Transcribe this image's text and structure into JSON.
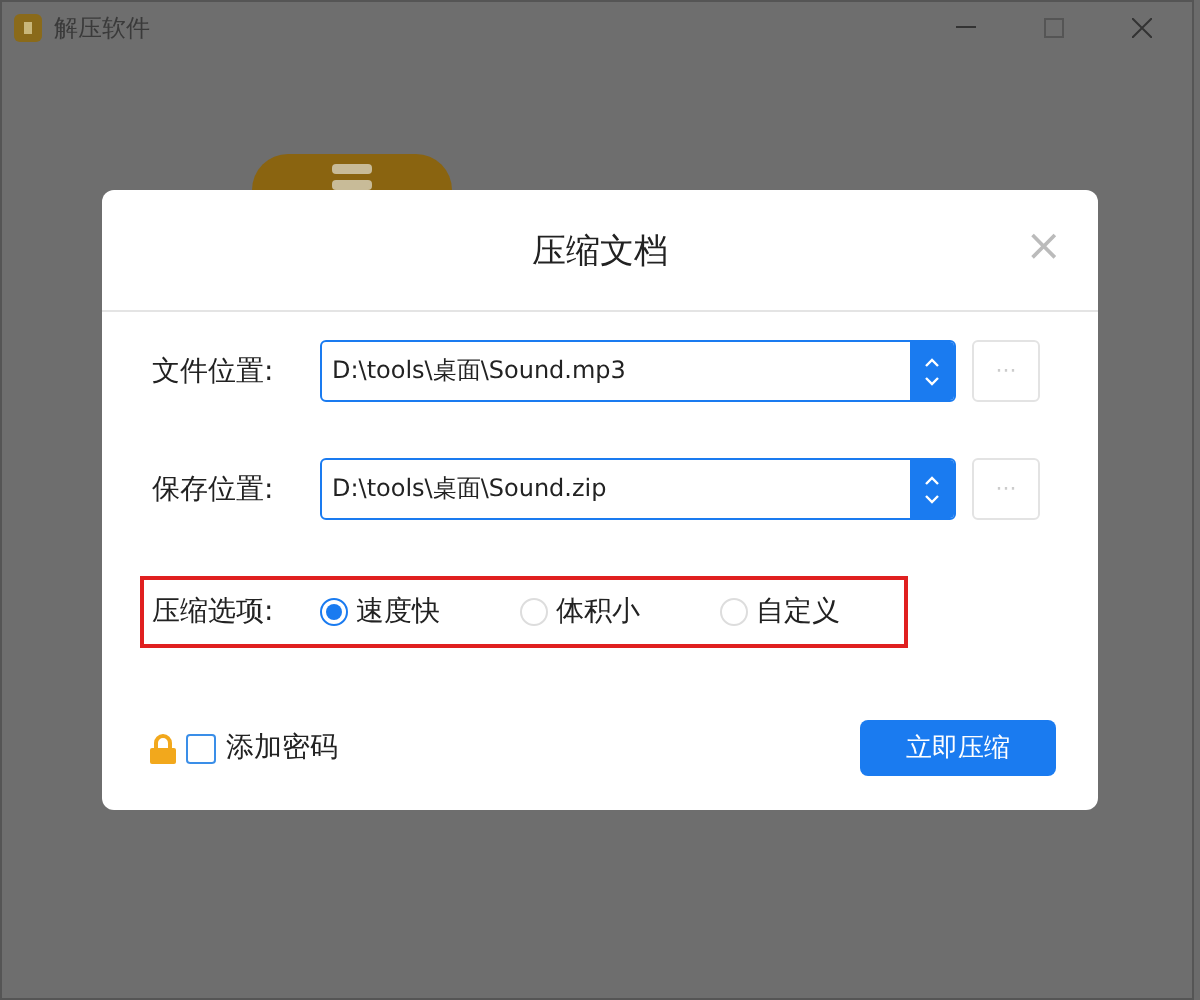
{
  "window": {
    "title": "解压软件"
  },
  "dialog": {
    "title": "压缩文档",
    "close": "×",
    "fields": [
      {
        "label": "文件位置:",
        "value": "D:\\tools\\桌面\\Sound.mp3",
        "browse": "···"
      },
      {
        "label": "保存位置:",
        "value": "D:\\tools\\桌面\\Sound.zip",
        "browse": "···"
      }
    ],
    "options": {
      "label": "压缩选项:",
      "items": [
        {
          "label": "速度快",
          "selected": true
        },
        {
          "label": "体积小",
          "selected": false
        },
        {
          "label": "自定义",
          "selected": false
        }
      ]
    },
    "password": {
      "label": "添加密码",
      "checked": false
    },
    "submit": "立即压缩"
  }
}
